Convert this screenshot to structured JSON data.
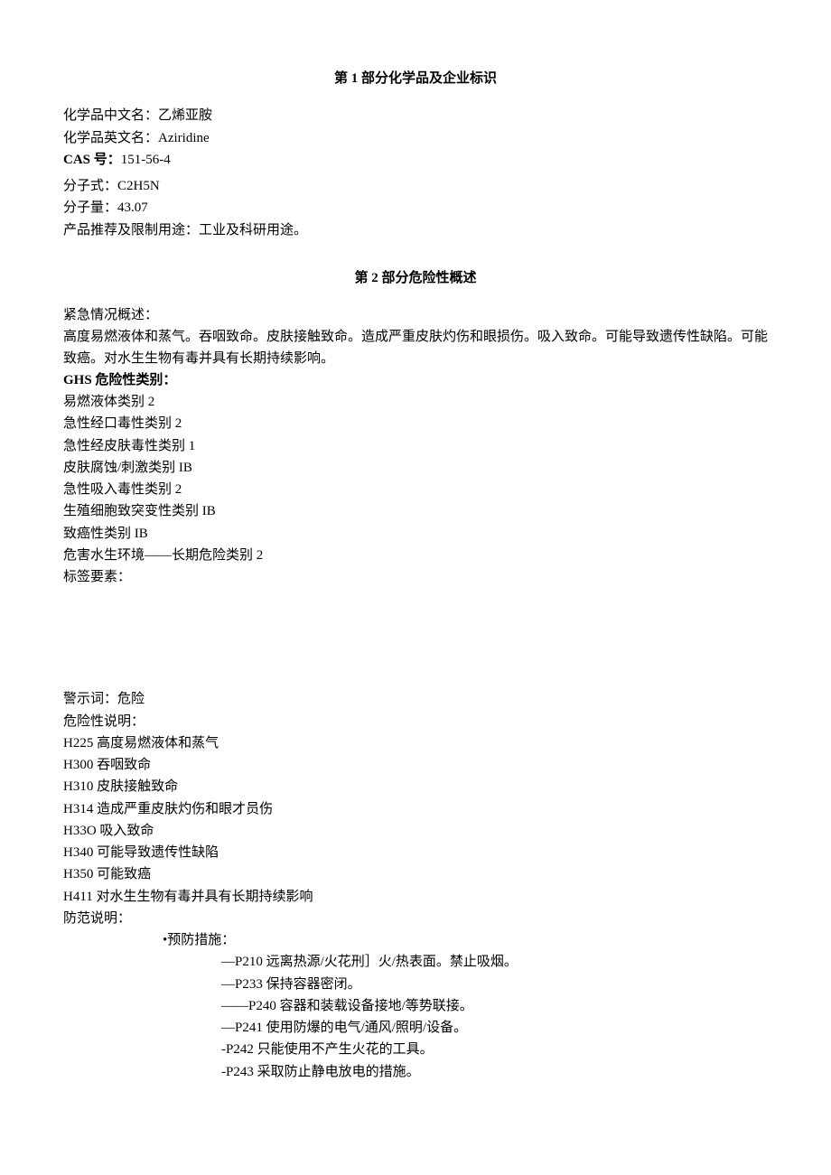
{
  "section1": {
    "title": "第 1 部分化学品及企业标识",
    "cn_name_label": "化学品中文名：",
    "cn_name": "乙烯亚胺",
    "en_name_label": "化学品英文名：",
    "en_name": "Aziridine",
    "cas_label": "CAS 号：",
    "cas": "151-56-4",
    "formula_label": "分子式：",
    "formula": "C2H5N",
    "mw_label": "分子量：",
    "mw": "43.07",
    "use_label": "产品推荐及限制用途：",
    "use": "工业及科研用途。"
  },
  "section2": {
    "title": "第 2 部分危险性概述",
    "emergency_label": "紧急情况概述：",
    "emergency_text": "高度易燃液体和蒸气。吞咽致命。皮肤接触致命。造成严重皮肤灼伤和眼损伤。吸入致命。可能导致遗传性缺陷。可能致癌。对水生生物有毒并具有长期持续影响。",
    "ghs_label": "GHS 危险性类别：",
    "ghs": [
      "易燃液体类别 2",
      "急性经口毒性类别 2",
      "急性经皮肤毒性类别 1",
      "皮肤腐蚀/刺激类别 IB",
      "急性吸入毒性类别 2",
      "生殖细胞致突变性类别 IB",
      "致癌性类别 IB",
      "危害水生环境——长期危险类别 2"
    ],
    "label_elements": "标签要素：",
    "signal_label": "警示词：",
    "signal": "危险",
    "hazard_label": "危险性说明：",
    "hazard": [
      "H225 高度易燃液体和蒸气",
      "H300 吞咽致命",
      "H310 皮肤接触致命",
      "H314 造成严重皮肤灼伤和眼才员伤",
      "H33O 吸入致命",
      "H340 可能导致遗传性缺陷",
      "H350 可能致癌",
      "H411 对水生生物有毒并具有长期持续影响"
    ],
    "prevent_label": "防范说明：",
    "prevent_sub": "•预防措施：",
    "prevent_items": [
      "—P210 远离热源/火花刑］火/热表面。禁止吸烟。",
      "—P233 保持容器密闭。",
      "——P240 容器和装载设备接地/等势联接。",
      "—P241 使用防爆的电气/通风/照明/设备。",
      "-P242 只能使用不产生火花的工具。",
      "-P243 采取防止静电放电的措施。"
    ]
  }
}
